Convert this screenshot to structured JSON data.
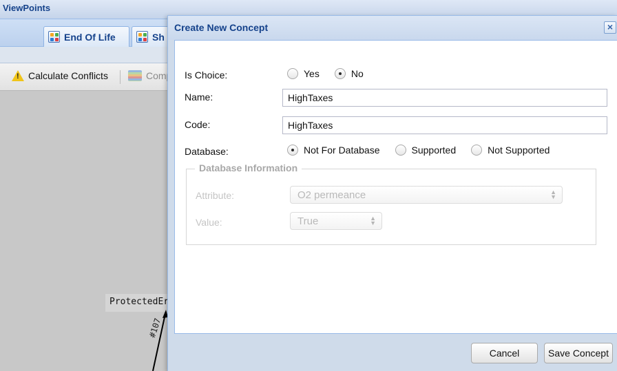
{
  "background": {
    "panel_title": "ViewPoints",
    "tabs": [
      {
        "label": "End Of Life",
        "icon": "grid-icon"
      },
      {
        "label": "Sh",
        "icon": "grid-icon"
      }
    ],
    "toolbar": {
      "calculate_conflicts": "Calculate Conflicts",
      "compare": "Comp"
    },
    "canvas": {
      "node_label": "ProtectedEr",
      "edge_label": "#107"
    }
  },
  "dialog": {
    "title": "Create New Concept",
    "is_choice": {
      "label": "Is Choice:",
      "options": [
        "Yes",
        "No"
      ],
      "selected": "No"
    },
    "name": {
      "label": "Name:",
      "value": "HighTaxes"
    },
    "code": {
      "label": "Code:",
      "value": "HighTaxes"
    },
    "database": {
      "label": "Database:",
      "options": [
        "Not For Database",
        "Supported",
        "Not Supported"
      ],
      "selected": "Not For Database"
    },
    "database_information": {
      "legend": "Database Information",
      "attribute_label": "Attribute:",
      "attribute_value": "O2 permeance",
      "value_label": "Value:",
      "value_value": "True"
    },
    "buttons": {
      "cancel": "Cancel",
      "save": "Save Concept"
    }
  },
  "colors": {
    "header_text": "#15428b",
    "dialog_border": "#99bbe8",
    "disabled_text": "#c4c4c4"
  }
}
